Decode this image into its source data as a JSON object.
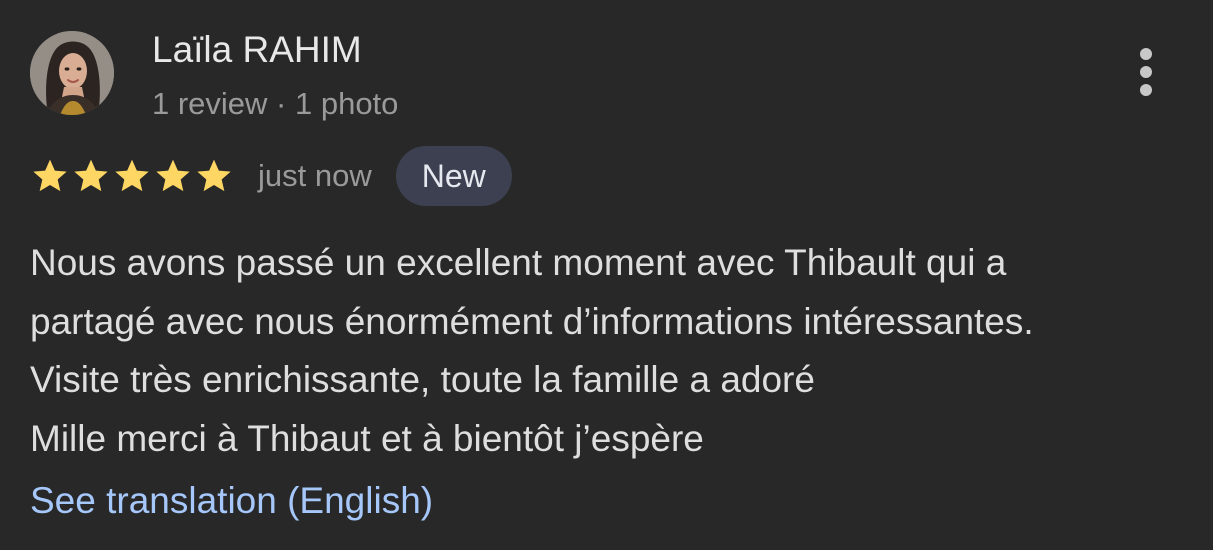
{
  "review": {
    "author": {
      "name": "Laïla RAHIM",
      "meta": "1 review · 1 photo",
      "avatar_icon": "user-photo-avatar"
    },
    "menu_icon": "more-vertical-icon",
    "rating": {
      "stars": 5,
      "max_stars": 5,
      "star_color": "#fdd663",
      "star_icon": "star-icon"
    },
    "time": "just now",
    "badge": "New",
    "text_lines": [
      "Nous avons passé un excellent moment avec Thibault qui a",
      "partagé avec nous énormément d’informations intéressantes.",
      "Visite très enrichissante, toute la famille a adoré",
      "Mille merci à Thibaut et à bientôt j’espère"
    ],
    "see_translation": "See translation (English)"
  },
  "colors": {
    "background": "#282828",
    "text": "#e3e3e3",
    "secondary_text": "#9a9a9a",
    "badge_background": "#3c4050",
    "link": "#a6c7fa"
  }
}
